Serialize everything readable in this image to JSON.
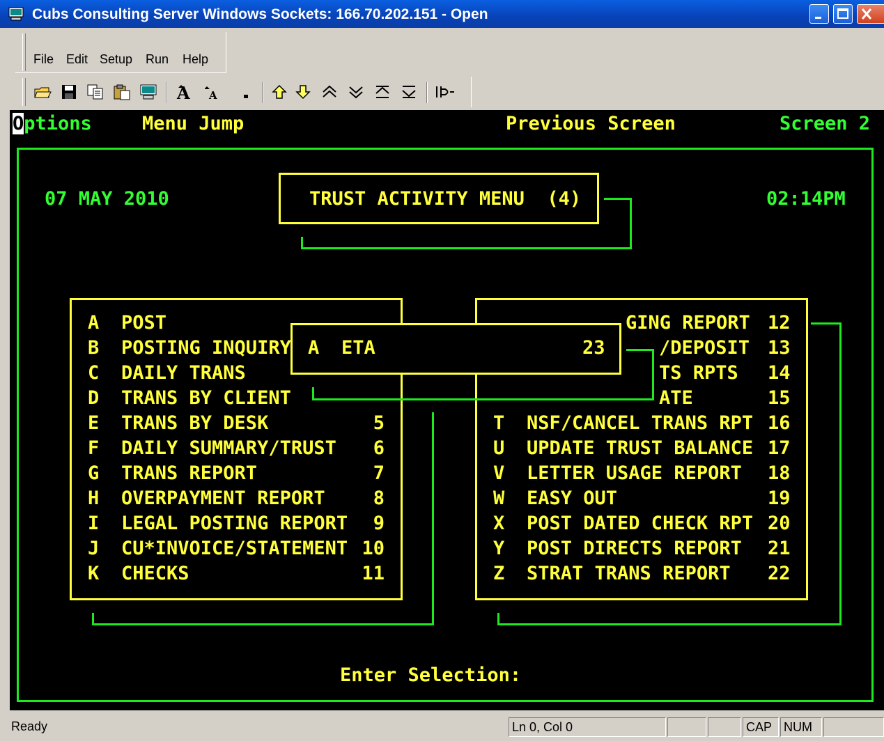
{
  "window": {
    "title": "Cubs Consulting Server Windows Sockets: 166.70.202.151 - Open"
  },
  "menu": [
    "File",
    "Edit",
    "Setup",
    "Run",
    "Help"
  ],
  "toolbar": {
    "icons": [
      "open-folder-icon",
      "save-disk-icon",
      "copy-icon",
      "paste-icon",
      "screen-icon",
      "font-larger-icon",
      "font-smaller-icon",
      "dot-icon",
      "up-arrow-icon",
      "down-arrow-icon",
      "page-up-icon",
      "page-down-icon",
      "top-icon",
      "bottom-icon",
      "connect-icon"
    ]
  },
  "terminal": {
    "cursor_char": "O",
    "options_rest": "ptions",
    "menu_jump": "Menu Jump",
    "previous_screen": "Previous Screen",
    "screen": "Screen 2",
    "date": "07 MAY 2010",
    "title": "TRUST ACTIVITY MENU  (4)",
    "time": "02:14PM",
    "left_items": [
      {
        "key": "A",
        "label": "POST",
        "num": ""
      },
      {
        "key": "B",
        "label": "POSTING INQUIRY",
        "num": ""
      },
      {
        "key": "C",
        "label": "DAILY TRANS",
        "num": ""
      },
      {
        "key": "D",
        "label": "TRANS BY CLIENT",
        "num": ""
      },
      {
        "key": "E",
        "label": "TRANS BY DESK",
        "num": "5"
      },
      {
        "key": "F",
        "label": "DAILY SUMMARY/TRUST",
        "num": "6"
      },
      {
        "key": "G",
        "label": "TRANS REPORT",
        "num": "7"
      },
      {
        "key": "H",
        "label": "OVERPAYMENT REPORT",
        "num": "8"
      },
      {
        "key": "I",
        "label": "LEGAL POSTING REPORT",
        "num": "9"
      },
      {
        "key": "J",
        "label": "CU*INVOICE/STATEMENT",
        "num": "10"
      },
      {
        "key": "K",
        "label": "CHECKS",
        "num": "11"
      }
    ],
    "right_partial": [
      {
        "label": "GING REPORT",
        "num": "12"
      },
      {
        "label": "/DEPOSIT",
        "num": "13"
      },
      {
        "label": "TS RPTS",
        "num": "14"
      },
      {
        "label": "ATE",
        "num": "15"
      }
    ],
    "right_items": [
      {
        "key": "T",
        "label": "NSF/CANCEL TRANS RPT",
        "num": "16"
      },
      {
        "key": "U",
        "label": "UPDATE TRUST BALANCE",
        "num": "17"
      },
      {
        "key": "V",
        "label": "LETTER USAGE REPORT",
        "num": "18"
      },
      {
        "key": "W",
        "label": "EASY OUT",
        "num": "19"
      },
      {
        "key": "X",
        "label": "POST DATED CHECK RPT",
        "num": "20"
      },
      {
        "key": "Y",
        "label": "POST DIRECTS REPORT",
        "num": "21"
      },
      {
        "key": "Z",
        "label": "STRAT TRANS REPORT",
        "num": "22"
      }
    ],
    "popup": {
      "key": "A",
      "label": "ETA",
      "num": "23"
    },
    "prompt": "Enter Selection:"
  },
  "status": {
    "ready": "Ready",
    "position": "Ln 0, Col 0",
    "cap": "CAP",
    "num": "NUM"
  }
}
